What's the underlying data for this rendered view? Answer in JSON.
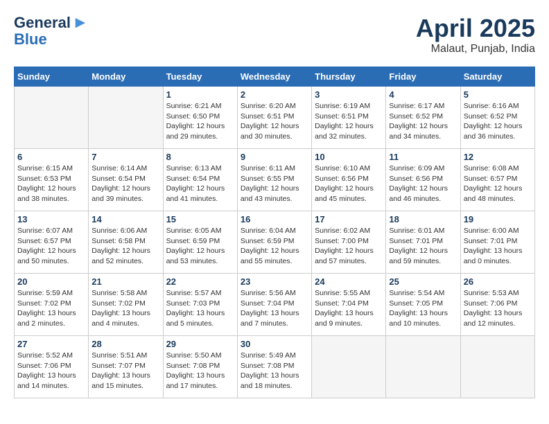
{
  "logo": {
    "line1": "General",
    "line2": "Blue"
  },
  "title": "April 2025",
  "location": "Malaut, Punjab, India",
  "weekdays": [
    "Sunday",
    "Monday",
    "Tuesday",
    "Wednesday",
    "Thursday",
    "Friday",
    "Saturday"
  ],
  "weeks": [
    [
      {
        "day": "",
        "info": ""
      },
      {
        "day": "",
        "info": ""
      },
      {
        "day": "1",
        "info": "Sunrise: 6:21 AM\nSunset: 6:50 PM\nDaylight: 12 hours\nand 29 minutes."
      },
      {
        "day": "2",
        "info": "Sunrise: 6:20 AM\nSunset: 6:51 PM\nDaylight: 12 hours\nand 30 minutes."
      },
      {
        "day": "3",
        "info": "Sunrise: 6:19 AM\nSunset: 6:51 PM\nDaylight: 12 hours\nand 32 minutes."
      },
      {
        "day": "4",
        "info": "Sunrise: 6:17 AM\nSunset: 6:52 PM\nDaylight: 12 hours\nand 34 minutes."
      },
      {
        "day": "5",
        "info": "Sunrise: 6:16 AM\nSunset: 6:52 PM\nDaylight: 12 hours\nand 36 minutes."
      }
    ],
    [
      {
        "day": "6",
        "info": "Sunrise: 6:15 AM\nSunset: 6:53 PM\nDaylight: 12 hours\nand 38 minutes."
      },
      {
        "day": "7",
        "info": "Sunrise: 6:14 AM\nSunset: 6:54 PM\nDaylight: 12 hours\nand 39 minutes."
      },
      {
        "day": "8",
        "info": "Sunrise: 6:13 AM\nSunset: 6:54 PM\nDaylight: 12 hours\nand 41 minutes."
      },
      {
        "day": "9",
        "info": "Sunrise: 6:11 AM\nSunset: 6:55 PM\nDaylight: 12 hours\nand 43 minutes."
      },
      {
        "day": "10",
        "info": "Sunrise: 6:10 AM\nSunset: 6:56 PM\nDaylight: 12 hours\nand 45 minutes."
      },
      {
        "day": "11",
        "info": "Sunrise: 6:09 AM\nSunset: 6:56 PM\nDaylight: 12 hours\nand 46 minutes."
      },
      {
        "day": "12",
        "info": "Sunrise: 6:08 AM\nSunset: 6:57 PM\nDaylight: 12 hours\nand 48 minutes."
      }
    ],
    [
      {
        "day": "13",
        "info": "Sunrise: 6:07 AM\nSunset: 6:57 PM\nDaylight: 12 hours\nand 50 minutes."
      },
      {
        "day": "14",
        "info": "Sunrise: 6:06 AM\nSunset: 6:58 PM\nDaylight: 12 hours\nand 52 minutes."
      },
      {
        "day": "15",
        "info": "Sunrise: 6:05 AM\nSunset: 6:59 PM\nDaylight: 12 hours\nand 53 minutes."
      },
      {
        "day": "16",
        "info": "Sunrise: 6:04 AM\nSunset: 6:59 PM\nDaylight: 12 hours\nand 55 minutes."
      },
      {
        "day": "17",
        "info": "Sunrise: 6:02 AM\nSunset: 7:00 PM\nDaylight: 12 hours\nand 57 minutes."
      },
      {
        "day": "18",
        "info": "Sunrise: 6:01 AM\nSunset: 7:01 PM\nDaylight: 12 hours\nand 59 minutes."
      },
      {
        "day": "19",
        "info": "Sunrise: 6:00 AM\nSunset: 7:01 PM\nDaylight: 13 hours\nand 0 minutes."
      }
    ],
    [
      {
        "day": "20",
        "info": "Sunrise: 5:59 AM\nSunset: 7:02 PM\nDaylight: 13 hours\nand 2 minutes."
      },
      {
        "day": "21",
        "info": "Sunrise: 5:58 AM\nSunset: 7:02 PM\nDaylight: 13 hours\nand 4 minutes."
      },
      {
        "day": "22",
        "info": "Sunrise: 5:57 AM\nSunset: 7:03 PM\nDaylight: 13 hours\nand 5 minutes."
      },
      {
        "day": "23",
        "info": "Sunrise: 5:56 AM\nSunset: 7:04 PM\nDaylight: 13 hours\nand 7 minutes."
      },
      {
        "day": "24",
        "info": "Sunrise: 5:55 AM\nSunset: 7:04 PM\nDaylight: 13 hours\nand 9 minutes."
      },
      {
        "day": "25",
        "info": "Sunrise: 5:54 AM\nSunset: 7:05 PM\nDaylight: 13 hours\nand 10 minutes."
      },
      {
        "day": "26",
        "info": "Sunrise: 5:53 AM\nSunset: 7:06 PM\nDaylight: 13 hours\nand 12 minutes."
      }
    ],
    [
      {
        "day": "27",
        "info": "Sunrise: 5:52 AM\nSunset: 7:06 PM\nDaylight: 13 hours\nand 14 minutes."
      },
      {
        "day": "28",
        "info": "Sunrise: 5:51 AM\nSunset: 7:07 PM\nDaylight: 13 hours\nand 15 minutes."
      },
      {
        "day": "29",
        "info": "Sunrise: 5:50 AM\nSunset: 7:08 PM\nDaylight: 13 hours\nand 17 minutes."
      },
      {
        "day": "30",
        "info": "Sunrise: 5:49 AM\nSunset: 7:08 PM\nDaylight: 13 hours\nand 18 minutes."
      },
      {
        "day": "",
        "info": ""
      },
      {
        "day": "",
        "info": ""
      },
      {
        "day": "",
        "info": ""
      }
    ]
  ]
}
